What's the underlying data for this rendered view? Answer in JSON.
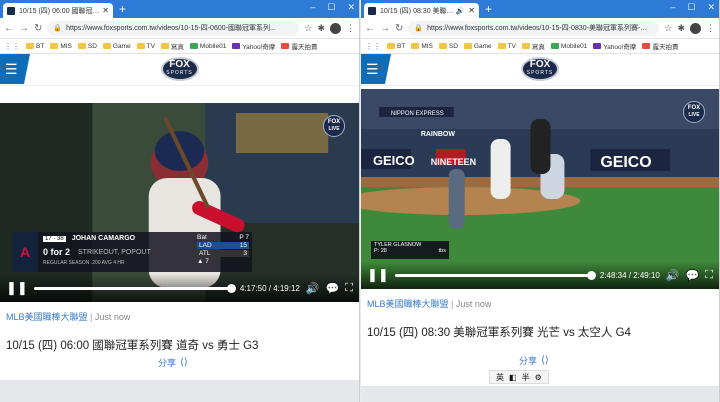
{
  "colors": {
    "chrome_blue": "#2d7bd6",
    "fox_navy": "#1b2a4a",
    "link_blue": "#3a7bc8"
  },
  "left": {
    "tab_title": "10/15 (四) 06:00 國聯冠軍系列賽",
    "url": "https://www.foxsports.com.tw/videos/10-15-四-0600-國聯冠軍系列...",
    "bookmarks": [
      "BT",
      "MIS",
      "SD",
      "Game",
      "TV",
      "寫真",
      "Mobile01",
      "Yahoo!奇摩",
      "露天拍賣"
    ],
    "logo": {
      "main": "FOX",
      "sub": "SPORTS"
    },
    "live_badge": {
      "main": "FOX",
      "sub": "LIVE"
    },
    "scoreboard": {
      "team_logo": "A",
      "avg": "17 · 38",
      "batter": "JOHAN CAMARGO",
      "count": "0 for 2",
      "result": "STRIKEOUT, POPOUT",
      "season": "REGULAR SEASON  .200 AVG  4 HR",
      "bat": "Bat",
      "inning": "P 7",
      "away": "LAD",
      "away_score": "15",
      "home": "ATL",
      "home_score": "3",
      "inning_arrow": "▲ 7"
    },
    "player": {
      "time": "4:17:50 / 4:19:12",
      "progress": 0.99
    },
    "category": "MLB美國職棒大聯盟",
    "ago": "Just now",
    "headline": "10/15 (四) 06:00 國聯冠軍系列賽 道奇 vs 勇士 G3",
    "share": "分享"
  },
  "right": {
    "tab_title": "10/15 (四) 08:30 美聯冠軍系列",
    "url": "https://www.foxsports.com.tw/videos/10-15-四-0830-美聯冠軍系列賽-光芒-vs-太空...",
    "bookmarks": [
      "BT",
      "MIS",
      "SD",
      "Game",
      "TV",
      "寫真",
      "Mobile01",
      "Yahoo!奇摩",
      "露天拍賣"
    ],
    "logo": {
      "main": "FOX",
      "sub": "SPORTS"
    },
    "live_badge": {
      "main": "FOX",
      "sub": "LIVE"
    },
    "ads": {
      "nippon": "NIPPON EXPRESS",
      "rainbow": "RAINBOW",
      "geico": "GEICO",
      "nineteen": "NINETEEN"
    },
    "pitcher_bar": {
      "name": "TYLER GLASNOW",
      "pitches": "P: 28",
      "net": "tbs"
    },
    "player": {
      "time": "2:48:34 / 2:49:10",
      "progress": 0.99
    },
    "category": "MLB美國職棒大聯盟",
    "ago": "Just now",
    "headline": "10/15 (四) 08:30 美聯冠軍系列賽 光芒 vs 太空人 G4",
    "share": "分享",
    "ime": [
      "英",
      "◧",
      "半",
      "⚙"
    ]
  },
  "window_controls": [
    "–",
    "☐",
    "✕"
  ],
  "sep": "|"
}
